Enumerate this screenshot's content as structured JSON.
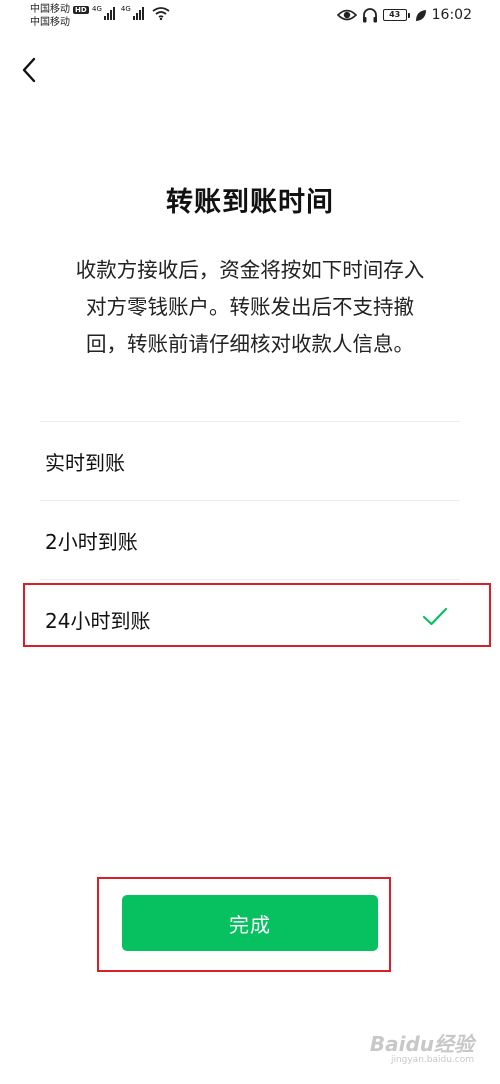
{
  "status_bar": {
    "carrier_1": "中国移动",
    "hd_badge": "HD",
    "carrier_2": "中国移动",
    "network_1": "4G",
    "network_2": "4G",
    "battery_level": "43",
    "time": "16:02",
    "icons": [
      "eye-icon",
      "headphones-icon",
      "battery-icon",
      "leaf-icon",
      "wifi-icon",
      "signal-icon"
    ]
  },
  "nav": {
    "back_icon": "chevron-left-icon"
  },
  "page": {
    "title": "转账到账时间",
    "description_lines": [
      "收款方接收后，资金将按如下时间存入",
      "对方零钱账户。转账发出后不支持撤",
      "回，转账前请仔细核对收款人信息。"
    ]
  },
  "options": [
    {
      "label": "实时到账",
      "selected": false
    },
    {
      "label": "2小时到账",
      "selected": false
    },
    {
      "label": "24小时到账",
      "selected": true
    }
  ],
  "done_button": {
    "label": "完成"
  },
  "colors": {
    "accent": "#07c160",
    "annotation": "#d8202a",
    "text": "#111111",
    "divider": "#ececec"
  },
  "watermark": {
    "main": "Baidu经验",
    "sub": "jingyan.baidu.com"
  }
}
